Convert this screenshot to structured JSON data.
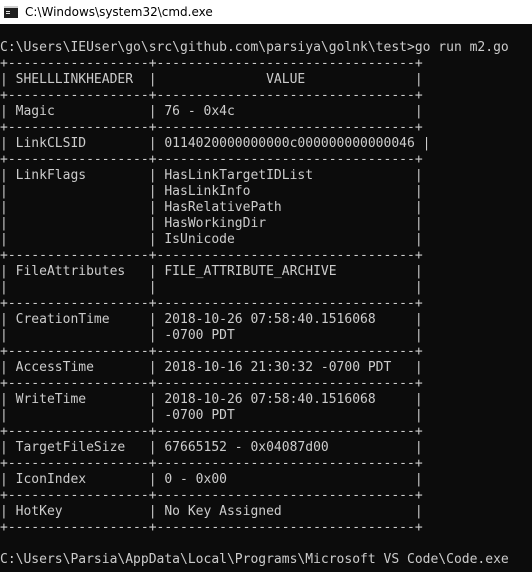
{
  "window": {
    "title": "C:\\Windows\\system32\\cmd.exe"
  },
  "console": {
    "command_line": "C:\\Users\\IEUser\\go\\src\\github.com\\parsiya\\golnk\\test>go run m2.go",
    "border": "+------------------+---------------------------------+",
    "header": "| SHELLLINKHEADER  |              VALUE              |",
    "rows": [
      {
        "lines": [
          "| Magic            | 76 - 0x4c                       |"
        ]
      },
      {
        "lines": [
          "| LinkCLSID        | 0114020000000000c000000000000046 |"
        ]
      },
      {
        "lines": [
          "| LinkFlags        | HasLinkTargetIDList             |",
          "|                  | HasLinkInfo                     |",
          "|                  | HasRelativePath                 |",
          "|                  | HasWorkingDir                   |",
          "|                  | IsUnicode                       |"
        ]
      },
      {
        "lines": [
          "| FileAttributes   | FILE_ATTRIBUTE_ARCHIVE          |",
          "|                  |                                 |"
        ]
      },
      {
        "lines": [
          "| CreationTime     | 2018-10-26 07:58:40.1516068     |",
          "|                  | -0700 PDT                       |"
        ]
      },
      {
        "lines": [
          "| AccessTime       | 2018-10-16 21:30:32 -0700 PDT   |"
        ]
      },
      {
        "lines": [
          "| WriteTime        | 2018-10-26 07:58:40.1516068     |",
          "|                  | -0700 PDT                       |"
        ]
      },
      {
        "lines": [
          "| TargetFileSize   | 67665152 - 0x04087d00           |"
        ]
      },
      {
        "lines": [
          "| IconIndex        | 0 - 0x00                        |"
        ]
      },
      {
        "lines": [
          "| HotKey           | No Key Assigned                 |"
        ]
      }
    ],
    "footer_prompt": "C:\\Users\\Parsia\\AppData\\Local\\Programs\\Microsoft VS Code\\Code.exe"
  },
  "colors": {
    "console_bg": "#0c0c0c",
    "console_text": "#cccccc",
    "titlebar_bg": "#ffffff"
  },
  "icons": {
    "app": "cmd-icon"
  }
}
